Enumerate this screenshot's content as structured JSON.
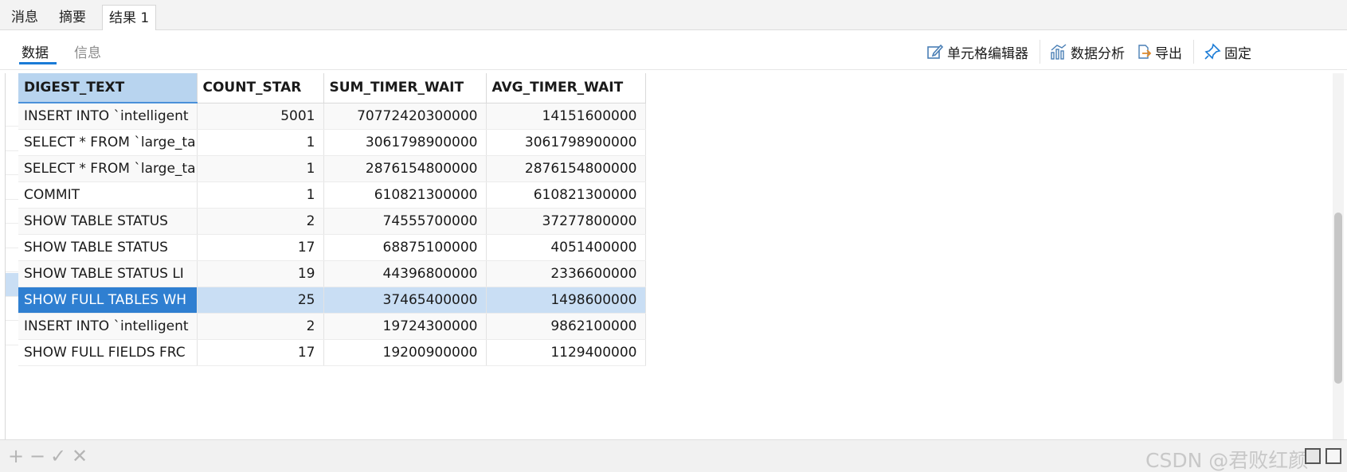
{
  "top_tabs": [
    {
      "label": "消息"
    },
    {
      "label": "摘要"
    },
    {
      "label": "结果 1",
      "active": true
    }
  ],
  "sub_tabs": [
    {
      "label": "数据",
      "active": true
    },
    {
      "label": "信息"
    }
  ],
  "toolbar": {
    "cell_editor": "单元格编辑器",
    "data_analysis": "数据分析",
    "export": "导出",
    "pin": "固定"
  },
  "grid": {
    "columns": [
      "DIGEST_TEXT",
      "COUNT_STAR",
      "SUM_TIMER_WAIT",
      "AVG_TIMER_WAIT"
    ],
    "rows": [
      {
        "digest": "INSERT INTO `intelligent",
        "count": "5001",
        "sum": "70772420300000",
        "avg": "14151600000"
      },
      {
        "digest": "SELECT * FROM `large_ta",
        "count": "1",
        "sum": "3061798900000",
        "avg": "3061798900000"
      },
      {
        "digest": "SELECT * FROM `large_ta",
        "count": "1",
        "sum": "2876154800000",
        "avg": "2876154800000"
      },
      {
        "digest": "COMMIT",
        "count": "1",
        "sum": "610821300000",
        "avg": "610821300000"
      },
      {
        "digest": "SHOW TABLE STATUS",
        "count": "2",
        "sum": "74555700000",
        "avg": "37277800000"
      },
      {
        "digest": "SHOW TABLE STATUS",
        "count": "17",
        "sum": "68875100000",
        "avg": "4051400000"
      },
      {
        "digest": "SHOW TABLE STATUS LI",
        "count": "19",
        "sum": "44396800000",
        "avg": "2336600000"
      },
      {
        "digest": "SHOW FULL TABLES WH",
        "count": "25",
        "sum": "37465400000",
        "avg": "1498600000"
      },
      {
        "digest": "INSERT INTO `intelligent",
        "count": "2",
        "sum": "19724300000",
        "avg": "9862100000"
      },
      {
        "digest": "SHOW FULL FIELDS FRC",
        "count": "17",
        "sum": "19200900000",
        "avg": "1129400000"
      }
    ],
    "selected_row_index": 7
  },
  "bottom_bar": {
    "add": "+",
    "remove": "−",
    "apply": "✓",
    "discard": "✕",
    "watermark": "CSDN @君败红颜"
  },
  "colors": {
    "accent": "#1a7bd6",
    "selected_row": "#c9def4",
    "selected_cell": "#2f7fd1",
    "header_selected": "#b8d4ef"
  },
  "icons": [
    "edit-icon",
    "chart-icon",
    "export-icon",
    "pin-icon",
    "grid-view-icon",
    "form-view-icon"
  ]
}
